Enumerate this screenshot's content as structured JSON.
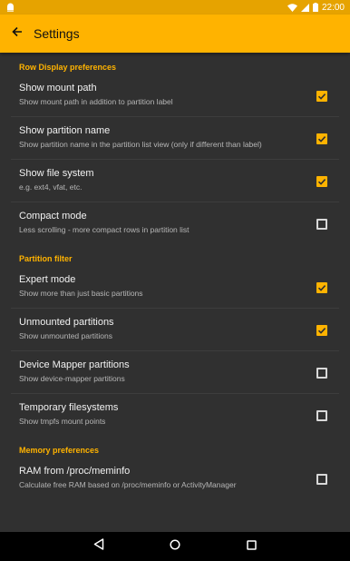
{
  "status": {
    "time": "22:00"
  },
  "appbar": {
    "title": "Settings"
  },
  "sections": [
    {
      "header": "Row Display preferences",
      "items": [
        {
          "title": "Show mount path",
          "summary": "Show mount path in addition to partition label",
          "checked": true
        },
        {
          "title": "Show partition name",
          "summary": "Show partition name in the partition list view (only if different than label)",
          "checked": true
        },
        {
          "title": "Show file system",
          "summary": "e.g. ext4, vfat, etc.",
          "checked": true
        },
        {
          "title": "Compact mode",
          "summary": "Less scrolling - more compact rows in partition list",
          "checked": false
        }
      ]
    },
    {
      "header": "Partition filter",
      "items": [
        {
          "title": "Expert mode",
          "summary": "Show more than just basic partitions",
          "checked": true
        },
        {
          "title": "Unmounted partitions",
          "summary": "Show unmounted partitions",
          "checked": true
        },
        {
          "title": "Device Mapper partitions",
          "summary": "Show device-mapper partitions",
          "checked": false
        },
        {
          "title": "Temporary filesystems",
          "summary": "Show tmpfs mount points",
          "checked": false
        }
      ]
    },
    {
      "header": "Memory preferences",
      "items": [
        {
          "title": "RAM from /proc/meminfo",
          "summary": "Calculate free RAM based on /proc/meminfo or ActivityManager",
          "checked": false
        }
      ]
    }
  ],
  "colors": {
    "accent": "#ffb300",
    "background": "#303030",
    "statusbar": "#e6a300"
  },
  "icons": {
    "back": "arrow-left-icon",
    "nav_back": "triangle-back-icon",
    "nav_home": "circle-home-icon",
    "nav_recents": "square-recents-icon"
  }
}
